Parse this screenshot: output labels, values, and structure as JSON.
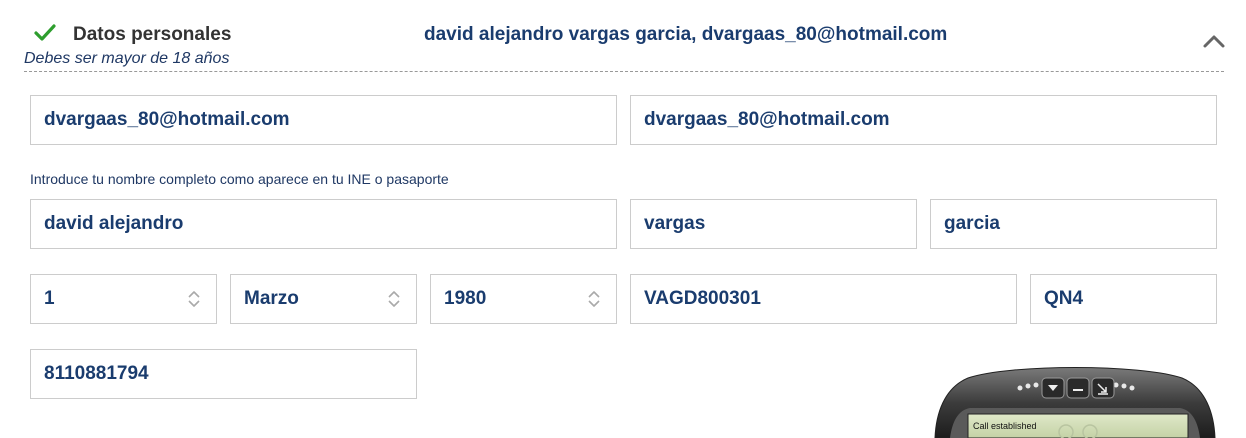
{
  "section": {
    "title": "Datos personales",
    "subtitle": "Debes ser mayor de 18 años",
    "summary": "david alejandro vargas garcia, dvargaas_80@hotmail.com"
  },
  "email": {
    "value": "dvargaas_80@hotmail.com",
    "confirm_value": "dvargaas_80@hotmail.com"
  },
  "name_hint": "Introduce tu nombre completo como aparece en tu INE o pasaporte",
  "name": {
    "first": "david alejandro",
    "paternal": "vargas",
    "maternal": "garcia"
  },
  "birth": {
    "day": "1",
    "month": "Marzo",
    "year": "1980"
  },
  "id": {
    "rfc": "VAGD800301",
    "homoclave": "QN4"
  },
  "phone": "8110881794",
  "softphone": {
    "status": "Call established"
  },
  "colors": {
    "check": "#2e9e2e",
    "field_text": "#1a3c6e",
    "border": "#cccccc"
  }
}
